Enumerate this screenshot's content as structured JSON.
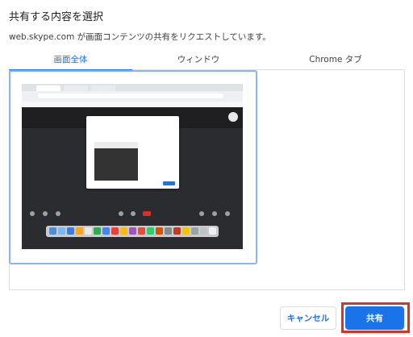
{
  "dialog": {
    "title": "共有する内容を選択",
    "subtitle": "web.skype.com が画面コンテンツの共有をリクエストしています。"
  },
  "tabs": [
    {
      "label": "画面全体",
      "selected": true
    },
    {
      "label": "ウィンドウ",
      "selected": false
    },
    {
      "label": "Chrome タブ",
      "selected": false
    }
  ],
  "sources": [
    {
      "type": "entire-screen",
      "selected": true
    }
  ],
  "buttons": {
    "cancel": "キャンセル",
    "share": "共有"
  },
  "colors": {
    "accent": "#1a73e8",
    "highlight_annotation": "#e0301e"
  }
}
